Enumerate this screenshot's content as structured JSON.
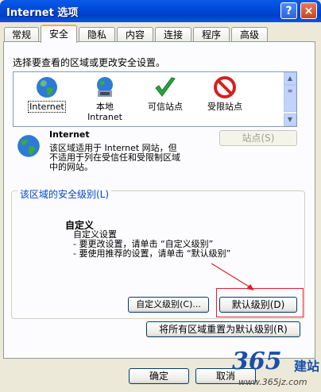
{
  "window": {
    "title": "Internet 选项",
    "help_label": "?",
    "close_label": "×"
  },
  "tabs": [
    {
      "label": "常规"
    },
    {
      "label": "安全"
    },
    {
      "label": "隐私"
    },
    {
      "label": "内容"
    },
    {
      "label": "连接"
    },
    {
      "label": "程序"
    },
    {
      "label": "高级"
    }
  ],
  "active_tab": "安全",
  "security": {
    "select_zone_prompt": "选择要查看的区域或更改安全设置。",
    "zones": [
      {
        "label": "Internet",
        "selected": true,
        "icon": "globe-icon"
      },
      {
        "label": "本地",
        "label2": "Intranet",
        "icon": "local-intranet-icon"
      },
      {
        "label": "可信站点",
        "icon": "trusted-check-icon"
      },
      {
        "label": "受限站点",
        "icon": "restricted-no-icon"
      }
    ],
    "zone_name": "Internet",
    "zone_desc": [
      "该区域适用于 Internet 网站，但",
      "不适用于列在受信任和受限制区域",
      "中的网站。"
    ],
    "sites_button": "站点(S)",
    "level_group_label": "该区域的安全级别(L)",
    "level_name": "自定义",
    "level_lines": [
      "自定义设置",
      "- 要更改设置，请单击 “自定义级别”",
      "- 要使用推荐的设置，请单击 “默认级别”"
    ],
    "custom_level_button": "自定义级别(C)...",
    "default_level_button": "默认级别(D)",
    "reset_all_button": "将所有区域重置为默认级别(R)"
  },
  "footer": {
    "ok_button": "确定",
    "partial_button": "取消"
  },
  "watermark": {
    "number": "365",
    "site": "建站",
    "url": "www.365jz.com"
  },
  "colors": {
    "titlebar": "#0048D8",
    "accent_link": "#0046D5",
    "highlight_box": "#E0202A"
  }
}
